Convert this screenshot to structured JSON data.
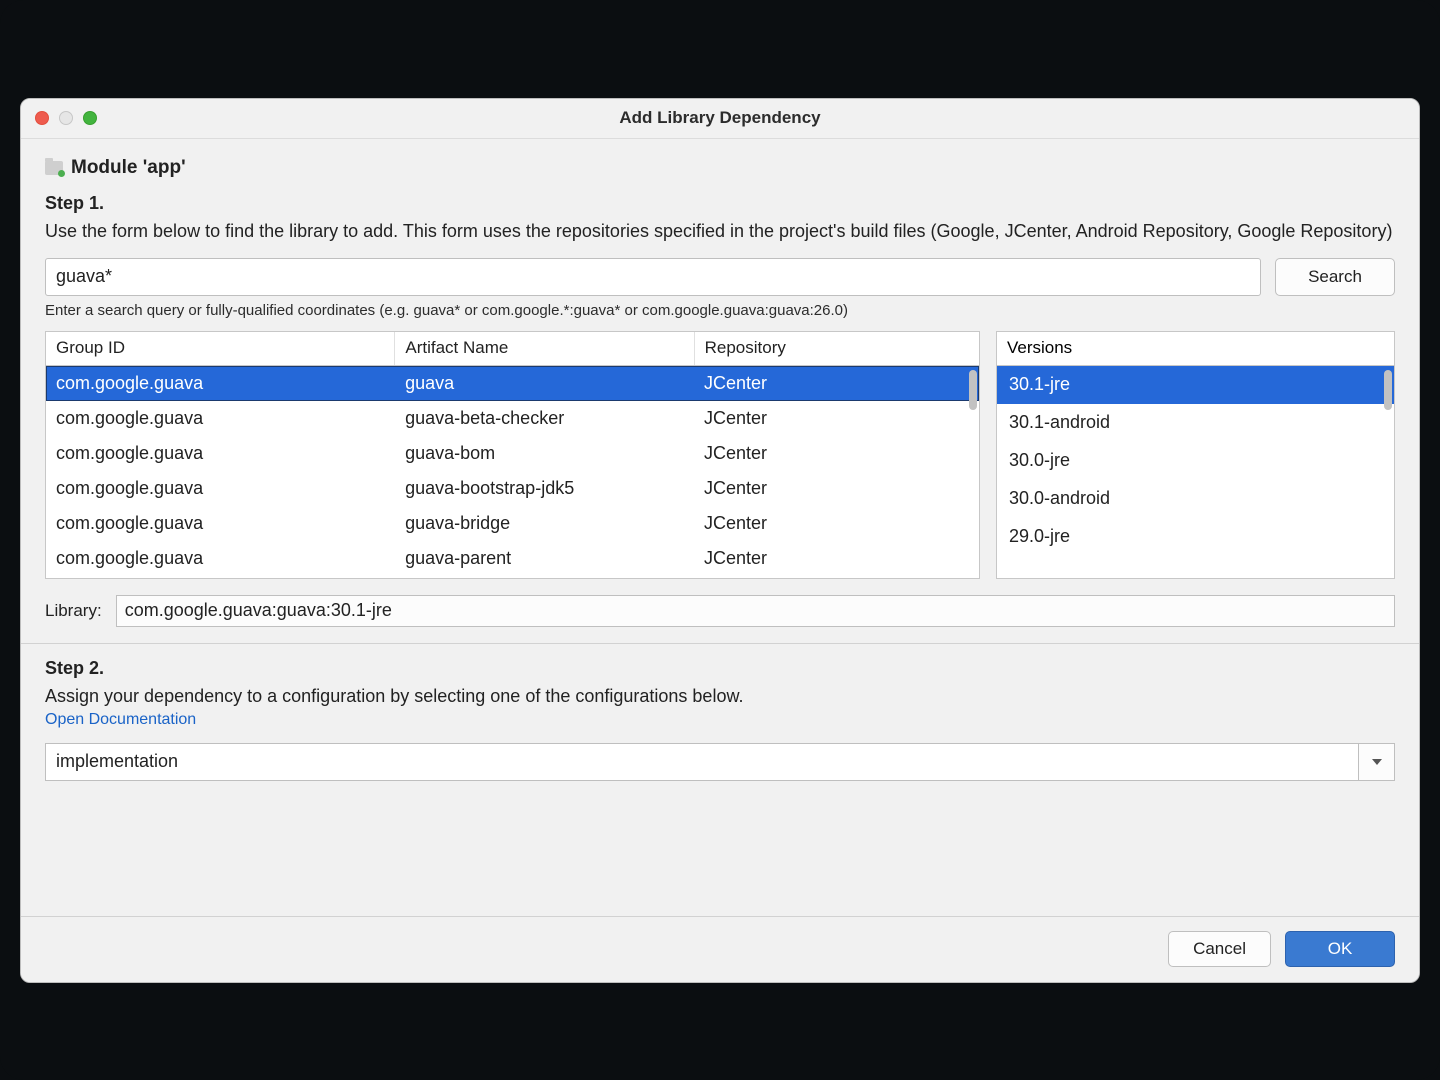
{
  "window": {
    "title": "Add Library Dependency"
  },
  "module": {
    "label": "Module 'app'"
  },
  "step1": {
    "heading": "Step 1.",
    "description": "Use the form below to find the library to add. This form uses the repositories specified in the project's build files (Google, JCenter, Android Repository, Google Repository)"
  },
  "search": {
    "value": "guava*",
    "button": "Search",
    "hint": "Enter a search query or fully-qualified coordinates (e.g. guava* or com.google.*:guava* or com.google.guava:guava:26.0)"
  },
  "columns": {
    "group": "Group ID",
    "artifact": "Artifact Name",
    "repo": "Repository",
    "versions": "Versions"
  },
  "results": [
    {
      "group": "com.google.guava",
      "artifact": "guava",
      "repo": "JCenter",
      "selected": true
    },
    {
      "group": "com.google.guava",
      "artifact": "guava-beta-checker",
      "repo": "JCenter",
      "selected": false
    },
    {
      "group": "com.google.guava",
      "artifact": "guava-bom",
      "repo": "JCenter",
      "selected": false
    },
    {
      "group": "com.google.guava",
      "artifact": "guava-bootstrap-jdk5",
      "repo": "JCenter",
      "selected": false
    },
    {
      "group": "com.google.guava",
      "artifact": "guava-bridge",
      "repo": "JCenter",
      "selected": false
    },
    {
      "group": "com.google.guava",
      "artifact": "guava-parent",
      "repo": "JCenter",
      "selected": false
    }
  ],
  "versions": [
    {
      "v": "30.1-jre",
      "selected": true
    },
    {
      "v": "30.1-android",
      "selected": false
    },
    {
      "v": "30.0-jre",
      "selected": false
    },
    {
      "v": "30.0-android",
      "selected": false
    },
    {
      "v": "29.0-jre",
      "selected": false
    }
  ],
  "library": {
    "label": "Library:",
    "value": "com.google.guava:guava:30.1-jre"
  },
  "step2": {
    "heading": "Step 2.",
    "description": "Assign your dependency to a configuration by selecting one of the configurations below.",
    "link": "Open Documentation"
  },
  "config": {
    "selected": "implementation"
  },
  "footer": {
    "cancel": "Cancel",
    "ok": "OK"
  }
}
